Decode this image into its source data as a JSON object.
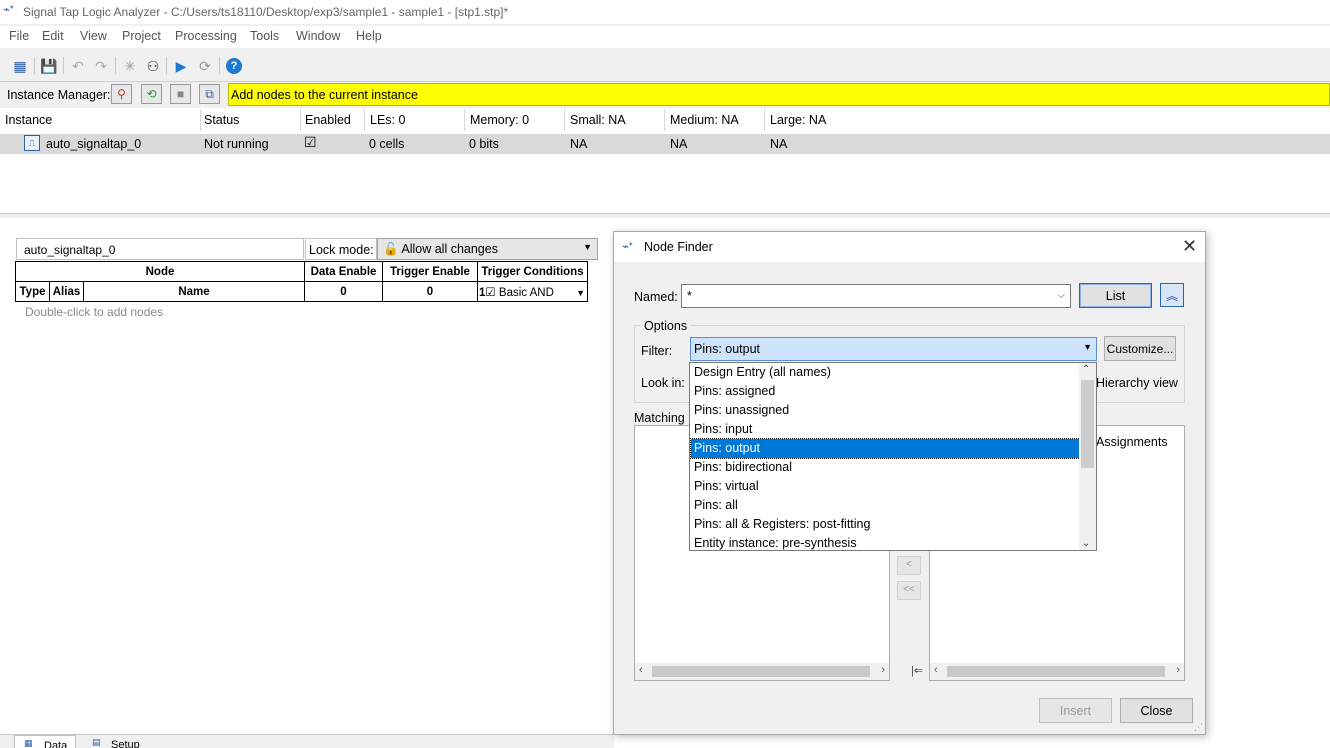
{
  "window": {
    "title": "Signal Tap Logic Analyzer - C:/Users/ts18110/Desktop/exp3/sample1 - sample1 - [stp1.stp]*"
  },
  "menu": [
    "File",
    "Edit",
    "View",
    "Project",
    "Processing",
    "Tools",
    "Window",
    "Help"
  ],
  "toolbar": {
    "icons": [
      "instance-manager-icon",
      "save-icon",
      "undo-icon",
      "redo-icon",
      "node-finder-icon",
      "find-icon",
      "run-icon",
      "autorun-icon",
      "help-icon"
    ]
  },
  "instance_manager": {
    "label": "Instance Manager:",
    "message": "Add nodes to the current instance",
    "message_color": "#ffff00"
  },
  "instance_table": {
    "headers": [
      "Instance",
      "Status",
      "Enabled",
      "LEs: 0",
      "Memory: 0",
      "Small: NA",
      "Medium: NA",
      "Large: NA"
    ],
    "row": {
      "instance": "auto_signaltap_0",
      "status": "Not running",
      "enabled": "☑",
      "les": "0 cells",
      "memory": "0 bits",
      "small": "NA",
      "medium": "NA",
      "large": "NA"
    }
  },
  "setup": {
    "instance_name": "auto_signaltap_0",
    "lock_mode_label": "Lock mode:",
    "lock_mode_value": "Allow all changes",
    "table": {
      "node": "Node",
      "data_enable": "Data Enable",
      "trigger_enable": "Trigger Enable",
      "trigger_conditions": "Trigger Conditions",
      "type": "Type",
      "alias": "Alias",
      "name": "Name",
      "data_enable_count": "0",
      "trigger_enable_count": "0",
      "trigger_index": "1",
      "trigger_check": "☑",
      "trigger_mode": "Basic AND"
    },
    "hint": "Double-click to add nodes"
  },
  "bottom_tabs": [
    "Data",
    "Setup"
  ],
  "dialog": {
    "title": "Node Finder",
    "named_label": "Named:",
    "named_value": "*",
    "list_button": "List",
    "options_label": "Options",
    "filter_label": "Filter:",
    "filter_value": "Pins: output",
    "customize_button": "Customize...",
    "look_in_label": "Look in:",
    "hierarchy_view": "Hierarchy view",
    "matching_label": "Matching N",
    "assignments_label": "Assignments",
    "move_buttons": [
      ">",
      ">>",
      "<",
      "<<"
    ],
    "insert_button": "Insert",
    "close_button": "Close"
  },
  "filter_options": [
    "Design Entry (all names)",
    "Pins: assigned",
    "Pins: unassigned",
    "Pins: input",
    "Pins: output",
    "Pins: bidirectional",
    "Pins: virtual",
    "Pins: all",
    "Pins: all & Registers: post-fitting",
    "Entity instance: pre-synthesis"
  ],
  "filter_selected_index": 4,
  "colors": {
    "accent": "#0078d7",
    "highlight_bar": "#ffff00"
  }
}
